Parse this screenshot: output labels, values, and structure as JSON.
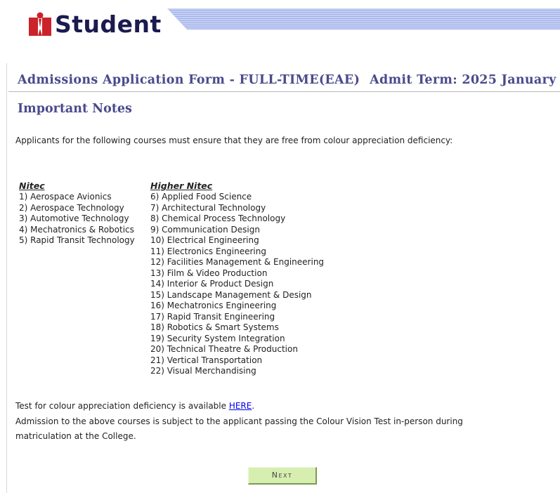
{
  "header": {
    "logo_text": "Student"
  },
  "form": {
    "title": "Admissions Application Form - FULL-TIME(EAE)",
    "admit_term": "Admit Term: 2025 January"
  },
  "notes": {
    "heading": "Important Notes",
    "intro": "Applicants for the following courses must ensure that they are free from colour appreciation deficiency:",
    "nitec": {
      "heading": "Nitec",
      "items": [
        "1) Aerospace Avionics",
        "2) Aerospace Technology",
        "3) Automotive Technology",
        "4) Mechatronics & Robotics",
        "5) Rapid Transit Technology"
      ]
    },
    "higher_nitec": {
      "heading": "Higher Nitec",
      "items": [
        "6) Applied Food Science",
        "7) Architectural Technology",
        "8) Chemical Process Technology",
        "9) Communication Design",
        "10) Electrical Engineering",
        "11) Electronics Engineering",
        "12) Facilities Management & Engineering",
        "13) Film & Video Production",
        "14) Interior & Product Design",
        "15) Landscape Management & Design",
        "16) Mechatronics Engineering",
        "17) Rapid Transit Engineering",
        "18) Robotics & Smart Systems",
        "19) Security System Integration",
        "20) Technical Theatre & Production",
        "21) Vertical Transportation",
        "22) Visual Merchandising"
      ]
    },
    "test_prefix": "Test for colour appreciation deficiency is available ",
    "test_link": "HERE",
    "test_suffix": ".",
    "admission_note": "Admission to the above courses is subject to the applicant passing the Colour Vision Test in-person during matriculation at the College."
  },
  "actions": {
    "next_label": "Next"
  },
  "colors": {
    "heading": "#4a4a8c",
    "logo_red": "#cc2229",
    "logo_navy": "#1b1b4f",
    "button_bg": "#d6efb0",
    "link": "#0000ee"
  }
}
